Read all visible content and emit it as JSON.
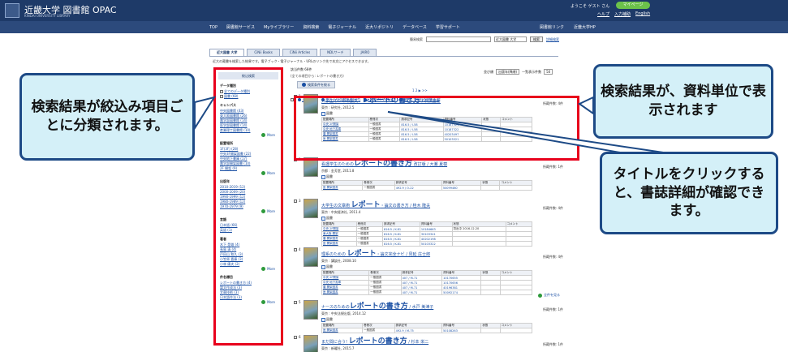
{
  "header": {
    "logo_title": "近畿大学 図書館 OPAC",
    "logo_subtitle": "KINDAI UNIVERSITY LIBRARY",
    "welcome": "ようこそ ゲスト さん",
    "mypage": "マイページ",
    "links": [
      "ヘルプ",
      "入力補助",
      "English"
    ]
  },
  "nav": {
    "items": [
      "TOP",
      "図書館サービス",
      "Myライブラリー",
      "資料検索",
      "電子ジャーナル",
      "近大リポジトリ",
      "データベース",
      "学習サポート"
    ],
    "right_items": [
      "図書館リンク",
      "近畿大学HP"
    ]
  },
  "search": {
    "label": "簡易検索",
    "scope": "近大図書 大学",
    "button": "検索",
    "advanced": "詳細検索"
  },
  "tabs": [
    "近大図書 大学",
    "CiNii Books",
    "CiNii Articles",
    "NDLサーチ",
    "JAIRO"
  ],
  "tab_description": "近大の蔵書を検索した結果です。電子ブック・電子ジャーナル・URLのリンク先で本文にアクセスできます。",
  "results": {
    "count": "該当件数 68件",
    "query": "(全ての項目から: レポートの書き方)",
    "refine": "検索条件を絞る",
    "sort_label": "並び順",
    "sort_value": "出版年(降順)",
    "per_page_label": "一覧表示件数",
    "per_page_value": "50",
    "pager": "1  2  ▶  >>",
    "actions": [
      "メール送信",
      "ファイル(文献管理)出力",
      "EndNote Web出力",
      "選択した資料の詳細表示"
    ]
  },
  "sidebar": {
    "top_button": "絞込検索",
    "groups": [
      {
        "title": "データ種別",
        "items": [
          "全てのデータ種別",
          "図書 (68)"
        ],
        "checkbox": true,
        "more": false
      },
      {
        "title": "キャンパス",
        "items": [
          "中央図書館 (43)",
          "東大阪図書館 (26)",
          "農学部図書館 (14)",
          "医学部図書館 (14)",
          "産業理工図書館 (10)"
        ],
        "checkbox": false,
        "more": true
      },
      {
        "title": "配置場所",
        "items": [
          "1F(3F) (28)",
          "中央3F開架図書 (22)",
          "中央地下書庫 (17)",
          "農学部開架図書 (10)",
          "2F 開架 (9)"
        ],
        "checkbox": false,
        "more": true
      },
      {
        "title": "出版年",
        "items": [
          "2010-2019 (12)",
          "2000-2009 (20)",
          "1990-1999 (12)",
          "1980-1989 (12)",
          "1970-1979 (9)"
        ],
        "checkbox": false,
        "more": true
      },
      {
        "title": "言語",
        "items": [
          "日本語 (66)",
          "英語 (1)"
        ],
        "checkbox": false,
        "more": false
      },
      {
        "title": "著者",
        "items": [
          "木下 是雄 (4)",
          "長島 清 (4)",
          "戸田山 和久 (3)",
          "小笠原 喜康 (3)",
          "小林 康夫 (2)"
        ],
        "checkbox": false,
        "more": true
      },
      {
        "title": "件名標目",
        "items": [
          "レポートの書き方 (4)",
          "論文作成法 (3)",
          "文章技術 (3)",
          "日本語作法 (3)"
        ],
        "checkbox": false,
        "more": true
      }
    ],
    "more_label": "More"
  },
  "records": [
    {
      "num": "1",
      "title_pre": "大学生のための論文・",
      "title_big": "レポートの書き方",
      "title_post": " / 石黒圭著",
      "publisher": "東京 : 研究社, 2012.5",
      "type": "図書",
      "holdings": "所蔵件数: 4件",
      "cols": [
        "配置場所",
        "巻冊次",
        "請求記号",
        "資料番号",
        "状態",
        "コメント"
      ],
      "rows": [
        [
          "中央 2F開架",
          "一般図書",
          "816.5 / I-58",
          "10187321",
          "",
          ""
        ],
        [
          "中央 地下書庫",
          "一般図書",
          "816.5 / I-58",
          "10187322",
          "",
          ""
        ],
        [
          "農 開架図書",
          "一般図書",
          "816.5 / I-58",
          "40203497",
          "",
          ""
        ],
        [
          "医 開架図書",
          "一般図書",
          "816.5 / I-58",
          "50103521",
          "",
          ""
        ]
      ]
    },
    {
      "num": "2",
      "title_pre": "看護学生のための",
      "title_big": "レポートの書き方",
      "title_post": " 改訂版 / 大瀬 夏樹",
      "publisher": "京都 : 金芳堂, 2011.8",
      "type": "図書",
      "holdings": "所蔵件数: 1件",
      "cols": [
        "配置場所",
        "巻冊次",
        "請求記号",
        "資料番号",
        "状態",
        "コメント"
      ],
      "rows": [
        [
          "医 開架図書",
          "一般図書",
          "492.9 / O-22",
          "50099460",
          "",
          ""
        ]
      ]
    },
    {
      "num": "3",
      "title_pre": "大学生の文章術 ",
      "title_big": "レポート",
      "title_post": "・論文の書き方 / 桂木 隆夫",
      "publisher": "東京 : 中央経済社, 2011.4",
      "type": "図書",
      "holdings": "所蔵件数: 4件",
      "cols": [
        "配置場所",
        "巻冊次",
        "請求記号",
        "資料番号",
        "状態",
        "コメント"
      ],
      "rows": [
        [
          "中央 2F開架",
          "一般図書",
          "816.5 / K-81",
          "10184663",
          "貸出中 2016.12.20",
          ""
        ],
        [
          "東大阪 開架",
          "一般図書",
          "816.5 / K-81",
          "30103341",
          "",
          ""
        ],
        [
          "農 開架図書",
          "一般図書",
          "816.5 / K-81",
          "40202198",
          "",
          ""
        ],
        [
          "医 開架図書",
          "一般図書",
          "816.5 / K-81",
          "50103322",
          "",
          ""
        ]
      ]
    },
    {
      "num": "4",
      "title_pre": "理系のための ",
      "title_big": "レポート",
      "title_post": "・論文完全ナビ / 見延 庄士郎",
      "publisher": "東京 : 講談社, 2008.10",
      "type": "図書",
      "holdings": "所蔵件数: 4件",
      "cols": [
        "配置場所",
        "巻冊次",
        "請求記号",
        "資料番号",
        "状態",
        "コメント"
      ],
      "rows": [
        [
          "中央 2F開架",
          "一般図書",
          "407 / M-71",
          "10170655",
          "",
          ""
        ],
        [
          "中央 地下書庫",
          "一般図書",
          "407 / M-71",
          "10170656",
          "",
          ""
        ],
        [
          "農 開架図書",
          "一般図書",
          "407 / M-71",
          "40196381",
          "",
          ""
        ],
        [
          "医 開架図書",
          "一般図書",
          "407 / M-71",
          "50092174",
          "",
          ""
        ]
      ]
    },
    {
      "num": "5",
      "title_pre": "ナースのための",
      "title_big": "レポートの書き方",
      "title_post": " / 水戸 美津子",
      "publisher": "東京 : 中央法規出版, 2014.12",
      "type": "図書",
      "holdings": "所蔵件数: 1件",
      "cols": [
        "配置場所",
        "巻冊次",
        "請求記号",
        "資料番号",
        "状態",
        "コメント"
      ],
      "rows": [
        [
          "医 開架図書",
          "一般図書",
          "492.9 / M-75",
          "50108263",
          "",
          ""
        ]
      ]
    },
    {
      "num": "6",
      "title_pre": "まだ間に合う! ",
      "title_big": "レポートの書き方",
      "title_post": " / 杉本 栄二",
      "publisher": "東京 : 新曜社, 2015.7",
      "type": "図書",
      "holdings": "所蔵件数: 1件",
      "cols": [],
      "rows": []
    }
  ],
  "view_all_label": "全件を見る",
  "callouts": {
    "left": "検索結果が絞込み項目ごとに分類されます。",
    "right_top": "検索結果が、資料単位で表示されます",
    "right_bottom": "タイトルをクリックすると、書誌詳細が確認できます。"
  },
  "colors": {
    "header_bg": "#1e3a68",
    "nav_bg": "#2c4a7c",
    "highlight_red": "#e8001c",
    "callout_fill": "#d4f0f8",
    "callout_border": "#1d4a86",
    "link_blue": "#1a4fa3",
    "mypage_green": "#6cc24a"
  }
}
